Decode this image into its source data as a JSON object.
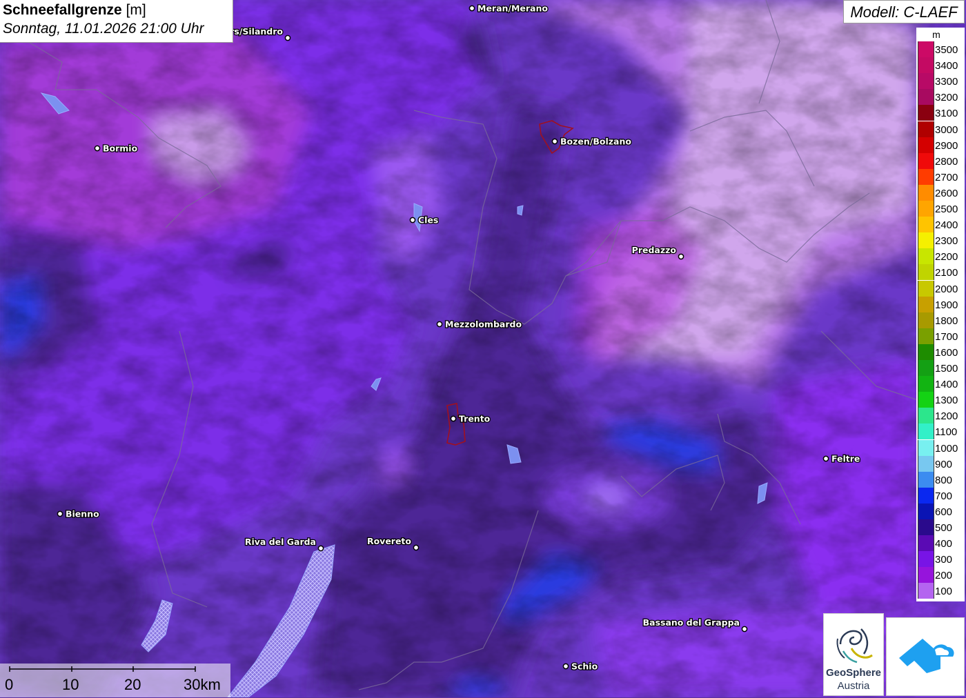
{
  "header": {
    "title_bold": "Schneefallgrenze",
    "title_unit": "[m]",
    "datetime": "Sonntag, 11.01.2026 21:00 Uhr"
  },
  "model": {
    "label": "Modell: C-LAEF"
  },
  "legend": {
    "unit": "m",
    "entries": [
      {
        "value": "3500",
        "color": "#cc0a66"
      },
      {
        "value": "3400",
        "color": "#c40a63"
      },
      {
        "value": "3300",
        "color": "#b80a66"
      },
      {
        "value": "3200",
        "color": "#a80a60"
      },
      {
        "value": "3100",
        "color": "#8a0010"
      },
      {
        "value": "3000",
        "color": "#b00000"
      },
      {
        "value": "2900",
        "color": "#d40000"
      },
      {
        "value": "2800",
        "color": "#f00a0a"
      },
      {
        "value": "2700",
        "color": "#ff3c00"
      },
      {
        "value": "2600",
        "color": "#ff8c00"
      },
      {
        "value": "2500",
        "color": "#ffa500"
      },
      {
        "value": "2400",
        "color": "#ffc400"
      },
      {
        "value": "2300",
        "color": "#f5f000"
      },
      {
        "value": "2200",
        "color": "#c8e600"
      },
      {
        "value": "2100",
        "color": "#c0d400"
      },
      {
        "value": "2000",
        "color": "#c8c800"
      },
      {
        "value": "1900",
        "color": "#c8a000"
      },
      {
        "value": "1800",
        "color": "#a89a00"
      },
      {
        "value": "1700",
        "color": "#7aa000"
      },
      {
        "value": "1600",
        "color": "#1e8c00"
      },
      {
        "value": "1500",
        "color": "#14a014"
      },
      {
        "value": "1400",
        "color": "#12b412"
      },
      {
        "value": "1300",
        "color": "#14d214"
      },
      {
        "value": "1200",
        "color": "#2ce68c"
      },
      {
        "value": "1100",
        "color": "#32f0c8"
      },
      {
        "value": "1000",
        "color": "#78f0f0"
      },
      {
        "value": "900",
        "color": "#78c8f0"
      },
      {
        "value": "800",
        "color": "#3c8cf0"
      },
      {
        "value": "700",
        "color": "#0a28f0"
      },
      {
        "value": "600",
        "color": "#0a14b4"
      },
      {
        "value": "500",
        "color": "#2a0a8c"
      },
      {
        "value": "400",
        "color": "#5a0ab4"
      },
      {
        "value": "300",
        "color": "#7814e6"
      },
      {
        "value": "200",
        "color": "#9614dc"
      },
      {
        "value": "100",
        "color": "#b464f0"
      }
    ]
  },
  "cities": [
    {
      "name": "Meran/Merano",
      "side": "right"
    },
    {
      "name": "rs/Silandro",
      "side": "left"
    },
    {
      "name": "Bormio",
      "side": "right"
    },
    {
      "name": "Bozen/Bolzano",
      "side": "right"
    },
    {
      "name": "Cles",
      "side": "right"
    },
    {
      "name": "Predazzo",
      "side": "left"
    },
    {
      "name": "Mezzolombardo",
      "side": "right"
    },
    {
      "name": "Trento",
      "side": "right"
    },
    {
      "name": "Feltre",
      "side": "right"
    },
    {
      "name": "Bienno",
      "side": "right"
    },
    {
      "name": "Riva del Garda",
      "side": "left"
    },
    {
      "name": "Rovereto",
      "side": "left"
    },
    {
      "name": "Bassano del Grappa",
      "side": "left"
    },
    {
      "name": "Schio",
      "side": "right"
    }
  ],
  "scale": {
    "ticks": [
      "0",
      "10",
      "20",
      "30km"
    ]
  },
  "logos": {
    "geosphere_name": "GeoSphere",
    "geosphere_sub": "Austria"
  }
}
